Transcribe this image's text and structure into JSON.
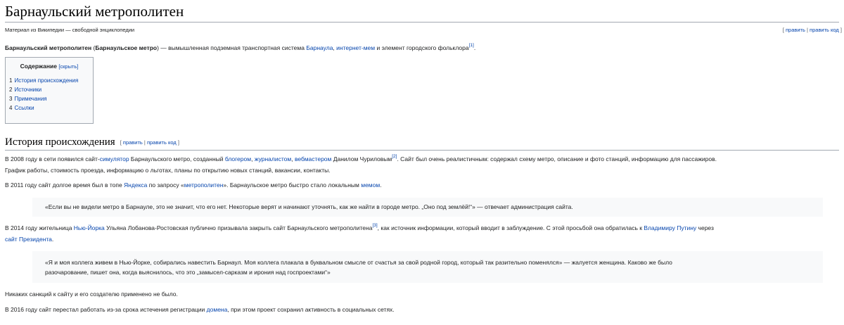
{
  "title": "Барнаульский метрополитен",
  "tagline": "Материал из Википедии — свободной энциклопедии",
  "edit_links": {
    "open": "[",
    "edit": "править",
    "sep": "|",
    "edit_code": "править код",
    "close": "]"
  },
  "lead": {
    "bold1": "Барнаульский метрополитен",
    "t1": " (",
    "bold2": "Барнаульское метро",
    "t2": ") — вымышленная подземная транспортная система ",
    "link1": "Барнаула",
    "t3": ", ",
    "link2": "интернет-мем",
    "t4": " и элемент городского фольклора",
    "ref": "[1]",
    "t5": "."
  },
  "toc": {
    "heading": "Содержание",
    "toggle": "[скрыть]",
    "items": [
      {
        "num": "1",
        "label": "История происхождения"
      },
      {
        "num": "2",
        "label": "Источники"
      },
      {
        "num": "3",
        "label": "Примечания"
      },
      {
        "num": "4",
        "label": "Ссылки"
      }
    ]
  },
  "section": {
    "heading": "История происхождения",
    "edit_open": "[",
    "edit": "править",
    "sep": "|",
    "edit_code": "править код",
    "edit_close": "]"
  },
  "p1": {
    "t1": "В 2008 году в сети появился сайт-",
    "l1": "симулятор",
    "t2": " Барнаульского метро, созданный ",
    "l2": "блогером",
    "t3": ", ",
    "l3": "журналистом",
    "t4": ", ",
    "l4": "вебмастером",
    "t5": " Данилом Чуриловым",
    "ref": "[2]",
    "t6": ". Сайт был очень реалистичным: содержал схему метро, описание и фото станций, информацию для пассажиров.",
    "line2": "График работы, стоимость проезда, информацию о льготах, планы по открытию новых станций, вакансии, контакты."
  },
  "p2": {
    "t1": "В 2011 году сайт долгое время был в топе ",
    "l1": "Яндекса",
    "t2": " по запросу «",
    "l2": "метрополитен",
    "t3": "». Барнаульское метро быстро стало локальным ",
    "l3": "мемом",
    "t4": "."
  },
  "quote1": "«Если вы не видели метро в Барнауле, это не значит, что его нет. Некоторые верят и начинают уточнять, как же найти в городе метро. „Оно под землёй!“» — отвечает администрация сайта.",
  "p3": {
    "t1": "В 2014 году жительница ",
    "l1": "Нью-Йорка",
    "t2": " Ульяна Лобанова-Ростовская публично призывала закрыть сайт Барнаульского метрополитена",
    "ref": "[3]",
    "t3": ", как источник информации, который вводит в заблуждение. С этой просьбой она обратилась к ",
    "l2": "Владимиру Путину",
    "t4": " через",
    "l3": "сайт Президента",
    "t5": "."
  },
  "quote2": {
    "line1": "«Я и моя коллега живем в Нью-Йорке, собирались навестить Барнаул. Моя коллега плакала в буквальном смысле от счастья за свой родной город, который так разительно поменялся» — жалуется женщина. Каково же было",
    "line2": "разочарование, пишет она, когда выяснилось, что это „замысел-сарказм и ирония над госпроектами“»"
  },
  "p4": "Никаких санкций к сайту и его создателю применено не было.",
  "p5": {
    "t1": "В 2016 году сайт перестал работать из-за срока истечения регистрации ",
    "l1": "домена",
    "t2": ", при этом проект сохранил активность в социальных сетях."
  }
}
